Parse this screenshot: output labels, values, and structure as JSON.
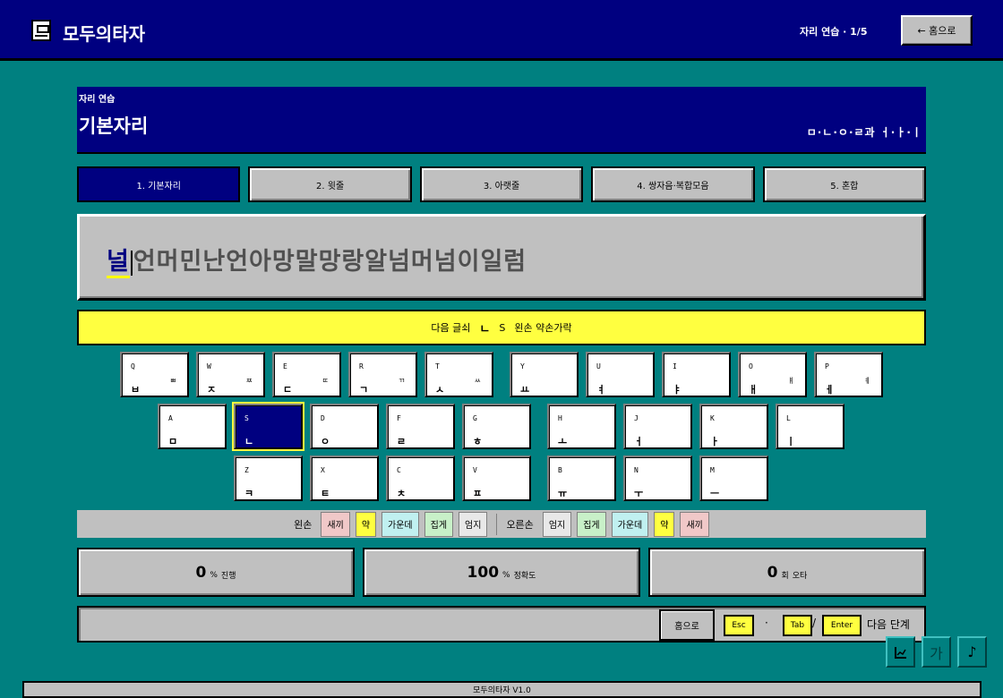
{
  "app": {
    "title": "모두의타자",
    "progress": "자리 연습 · 1/5",
    "home_button": "← 홈으로",
    "version": "모두의타자 V1.0"
  },
  "header": {
    "subtitle": "자리 연습",
    "title": "기본자리",
    "keys": "ㅁ·ㄴ·ㅇ·ㄹ과 ㅓ·ㅏ·ㅣ"
  },
  "tabs": [
    {
      "label": "1. 기본자리",
      "active": true
    },
    {
      "label": "2. 윗줄",
      "active": false
    },
    {
      "label": "3. 아랫줄",
      "active": false
    },
    {
      "label": "4. 쌍자음·복합모음",
      "active": false
    },
    {
      "label": "5. 혼합",
      "active": false
    }
  ],
  "practice": {
    "current": "널",
    "rest": "언머민난언아망말망랑알넘머넘이일럼"
  },
  "hint": {
    "prefix": "다음 글쇠",
    "key": "ㄴ",
    "code": "S",
    "finger": "왼손 약손가락"
  },
  "keyboard": {
    "row1": [
      {
        "eng": "Q",
        "kor": "ㅂ",
        "shift": "ㅃ"
      },
      {
        "eng": "W",
        "kor": "ㅈ",
        "shift": "ㅉ"
      },
      {
        "eng": "E",
        "kor": "ㄷ",
        "shift": "ㄸ"
      },
      {
        "eng": "R",
        "kor": "ㄱ",
        "shift": "ㄲ"
      },
      {
        "eng": "T",
        "kor": "ㅅ",
        "shift": "ㅆ"
      },
      {
        "eng": "Y",
        "kor": "ㅛ",
        "shift": ""
      },
      {
        "eng": "U",
        "kor": "ㅕ",
        "shift": ""
      },
      {
        "eng": "I",
        "kor": "ㅑ",
        "shift": ""
      },
      {
        "eng": "O",
        "kor": "ㅐ",
        "shift": "ㅒ"
      },
      {
        "eng": "P",
        "kor": "ㅔ",
        "shift": "ㅖ"
      }
    ],
    "row2": [
      {
        "eng": "A",
        "kor": "ㅁ"
      },
      {
        "eng": "S",
        "kor": "ㄴ"
      },
      {
        "eng": "D",
        "kor": "ㅇ"
      },
      {
        "eng": "F",
        "kor": "ㄹ"
      },
      {
        "eng": "G",
        "kor": "ㅎ"
      },
      {
        "eng": "H",
        "kor": "ㅗ"
      },
      {
        "eng": "J",
        "kor": "ㅓ"
      },
      {
        "eng": "K",
        "kor": "ㅏ"
      },
      {
        "eng": "L",
        "kor": "ㅣ"
      }
    ],
    "row3": [
      {
        "eng": "Z",
        "kor": "ㅋ"
      },
      {
        "eng": "X",
        "kor": "ㅌ"
      },
      {
        "eng": "C",
        "kor": "ㅊ"
      },
      {
        "eng": "V",
        "kor": "ㅍ"
      },
      {
        "eng": "B",
        "kor": "ㅠ"
      },
      {
        "eng": "N",
        "kor": "ㅜ"
      },
      {
        "eng": "M",
        "kor": "ㅡ"
      }
    ],
    "active_key": "S"
  },
  "fingers": {
    "left_label": "왼손",
    "left": [
      "새끼",
      "약",
      "가운데",
      "집게",
      "엄지"
    ],
    "right_label": "오른손",
    "right": [
      "엄지",
      "집게",
      "가운데",
      "약",
      "새끼"
    ],
    "colors": {
      "새끼": "#f0c8c8",
      "약": "#ffff40",
      "가운데": "#c0f0f0",
      "집게": "#c8f0c8",
      "엄지": "#e8e8e8"
    }
  },
  "stats": {
    "progress_value": "0",
    "progress_unit": "%",
    "progress_label": "진행",
    "accuracy_value": "100",
    "accuracy_unit": "%",
    "accuracy_label": "정확도",
    "errors_value": "0",
    "errors_unit": "회",
    "errors_label": "오타"
  },
  "bottom": {
    "home": "홈으로",
    "esc": "Esc",
    "dot": "·",
    "tab": "Tab",
    "slash": "/",
    "enter": "Enter",
    "next": "다음 단계"
  },
  "floats": {
    "stats_icon": "chart-icon",
    "font_icon": "가",
    "sound_icon": "♪"
  }
}
